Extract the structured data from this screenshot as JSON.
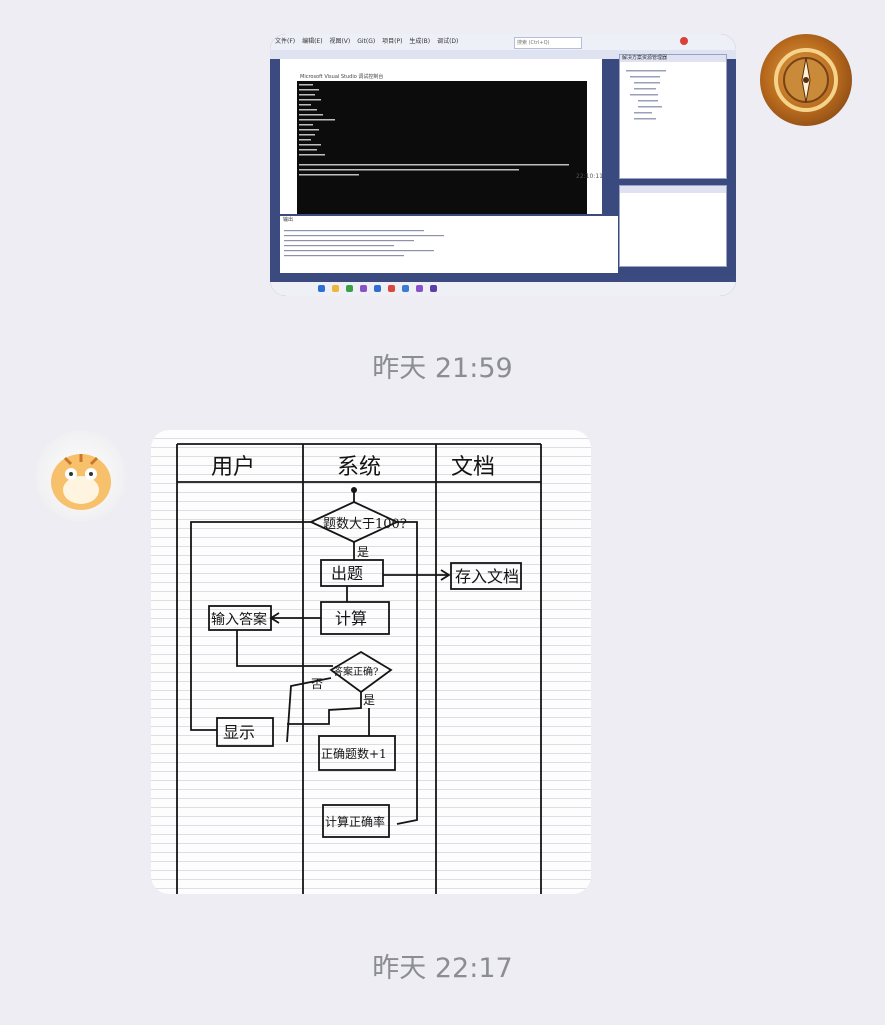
{
  "chat": {
    "messages": [
      {
        "side": "right",
        "type": "image",
        "description_id": "vs-screenshot",
        "vs": {
          "menu": [
            "文件(F)",
            "编辑(E)",
            "视图(V)",
            "Git(G)",
            "项目(P)",
            "生成(B)",
            "调试(D)",
            "测试(S)",
            "分析(N)",
            "工具(T)",
            "扩展(X)",
            "窗口(W)",
            "帮助(H)"
          ],
          "search_placeholder": "搜索 (Ctrl+Q)",
          "console_title": "Microsoft Visual Studio 调试控制台",
          "right_pane_title": "解决方案资源管理器",
          "output_label": "输出",
          "time_fragment": "22:10:11"
        }
      },
      {
        "type": "timestamp",
        "text": "昨天 21:59"
      },
      {
        "side": "left",
        "type": "image",
        "description_id": "handwritten-flowchart",
        "flowchart": {
          "lanes": [
            "用户",
            "系统",
            "文档"
          ],
          "nodes": {
            "decision_count": "题数大于100?",
            "yes1": "是",
            "generate": "出题",
            "store": "存入文档",
            "calculate": "计算",
            "input_answer": "输入答案",
            "decision_correct": "答案正确?",
            "no": "否",
            "yes2": "是",
            "display": "显示",
            "correct_plus": "正确题数+1",
            "calc_rate": "计算正确率"
          }
        }
      },
      {
        "type": "timestamp",
        "text": "昨天 22:17"
      }
    ]
  },
  "colors": {
    "background": "#ededf3",
    "timestamp": "#8c8c95",
    "vs_accent": "#3b4b7f"
  }
}
